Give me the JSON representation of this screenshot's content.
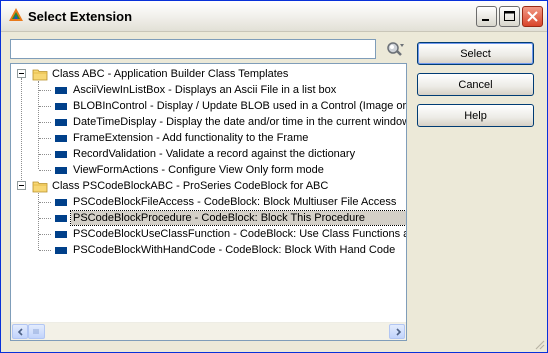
{
  "window": {
    "title": "Select Extension"
  },
  "search": {
    "value": "",
    "placeholder": ""
  },
  "buttons": {
    "select": "Select",
    "cancel": "Cancel",
    "help": "Help"
  },
  "tree": {
    "groups": [
      {
        "label": "Class ABC - Application Builder Class Templates",
        "expanded": true,
        "items": [
          "AsciiViewInListBox - Displays an Ascii File in a list box",
          "BLOBInControl - Display / Update BLOB used in a Control (Image or Te",
          "DateTimeDisplay - Display the date and/or time in the current window",
          "FrameExtension - Add functionality to the Frame",
          "RecordValidation - Validate a record against the dictionary",
          "ViewFormActions - Configure View Only form mode"
        ]
      },
      {
        "label": "Class PSCodeBlockABC - ProSeries CodeBlock for ABC",
        "expanded": true,
        "items": [
          "PSCodeBlockFileAccess - CodeBlock: Block Multiuser File Access",
          "PSCodeBlockProcedure - CodeBlock: Block This Procedure",
          "PSCodeBlockUseClassFunction - CodeBlock: Use Class Functions as",
          "PSCodeBlockWithHandCode - CodeBlock: Block With Hand Code"
        ]
      }
    ],
    "selected": "PSCodeBlockProcedure - CodeBlock: Block This Procedure"
  },
  "icons": {
    "app": "clarion-triangle-icon",
    "minimize": "minimize-icon",
    "maximize": "maximize-icon",
    "close": "close-icon",
    "search": "search-icon",
    "folder": "folder-icon"
  },
  "colors": {
    "close_button": "#e5624a",
    "titlebar_border": "#0831d9",
    "item_bullet": "#00408a",
    "selection": "#d4d0c8"
  }
}
